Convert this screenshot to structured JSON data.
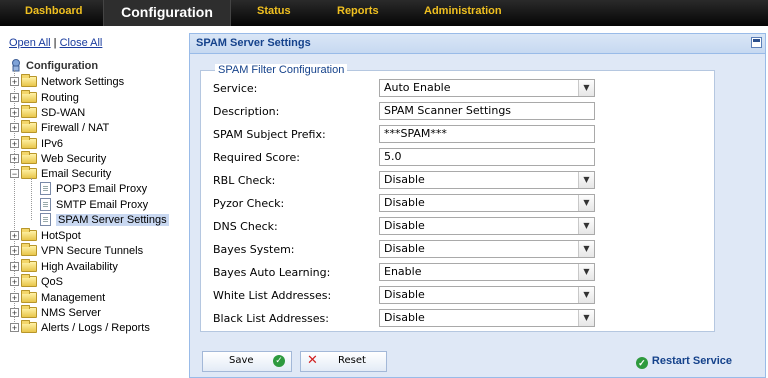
{
  "nav": {
    "items": [
      "Dashboard",
      "Configuration",
      "Status",
      "Reports",
      "Administration"
    ],
    "active": "Configuration"
  },
  "sidebar": {
    "open_all": "Open All",
    "separator": "|",
    "close_all": "Close All",
    "root": "Configuration",
    "items": [
      {
        "label": "Network Settings"
      },
      {
        "label": "Routing"
      },
      {
        "label": "SD-WAN"
      },
      {
        "label": "Firewall / NAT"
      },
      {
        "label": "IPv6"
      },
      {
        "label": "Web Security"
      },
      {
        "label": "Email Security",
        "children": [
          "POP3 Email Proxy",
          "SMTP Email Proxy",
          "SPAM Server Settings"
        ]
      },
      {
        "label": "HotSpot"
      },
      {
        "label": "VPN Secure Tunnels"
      },
      {
        "label": "High Availability"
      },
      {
        "label": "QoS"
      },
      {
        "label": "Management"
      },
      {
        "label": "NMS Server"
      },
      {
        "label": "Alerts / Logs / Reports"
      }
    ],
    "selected": "SPAM Server Settings"
  },
  "panel": {
    "title": "SPAM Server Settings",
    "fieldset_title": "SPAM Filter Configuration",
    "fields": [
      {
        "label": "Service:",
        "value": "Auto Enable",
        "type": "select"
      },
      {
        "label": "Description:",
        "value": "SPAM Scanner Settings",
        "type": "input"
      },
      {
        "label": "SPAM Subject Prefix:",
        "value": "***SPAM***",
        "type": "input"
      },
      {
        "label": "Required Score:",
        "value": "5.0",
        "type": "input"
      },
      {
        "label": "RBL Check:",
        "value": "Disable",
        "type": "select"
      },
      {
        "label": "Pyzor Check:",
        "value": "Disable",
        "type": "select"
      },
      {
        "label": "DNS Check:",
        "value": "Disable",
        "type": "select"
      },
      {
        "label": "Bayes System:",
        "value": "Disable",
        "type": "select"
      },
      {
        "label": "Bayes Auto Learning:",
        "value": "Enable",
        "type": "select"
      },
      {
        "label": "White List Addresses:",
        "value": "Disable",
        "type": "select"
      },
      {
        "label": "Black List Addresses:",
        "value": "Disable",
        "type": "select"
      }
    ],
    "buttons": {
      "save": "Save",
      "reset": "Reset",
      "restart": "Restart Service"
    }
  },
  "colors": {
    "nav_text": "#f0c020",
    "link": "#1a3c9e",
    "panel_title": "#15428b",
    "ok_green": "#2e9a3e",
    "reset_red": "#d02020"
  }
}
